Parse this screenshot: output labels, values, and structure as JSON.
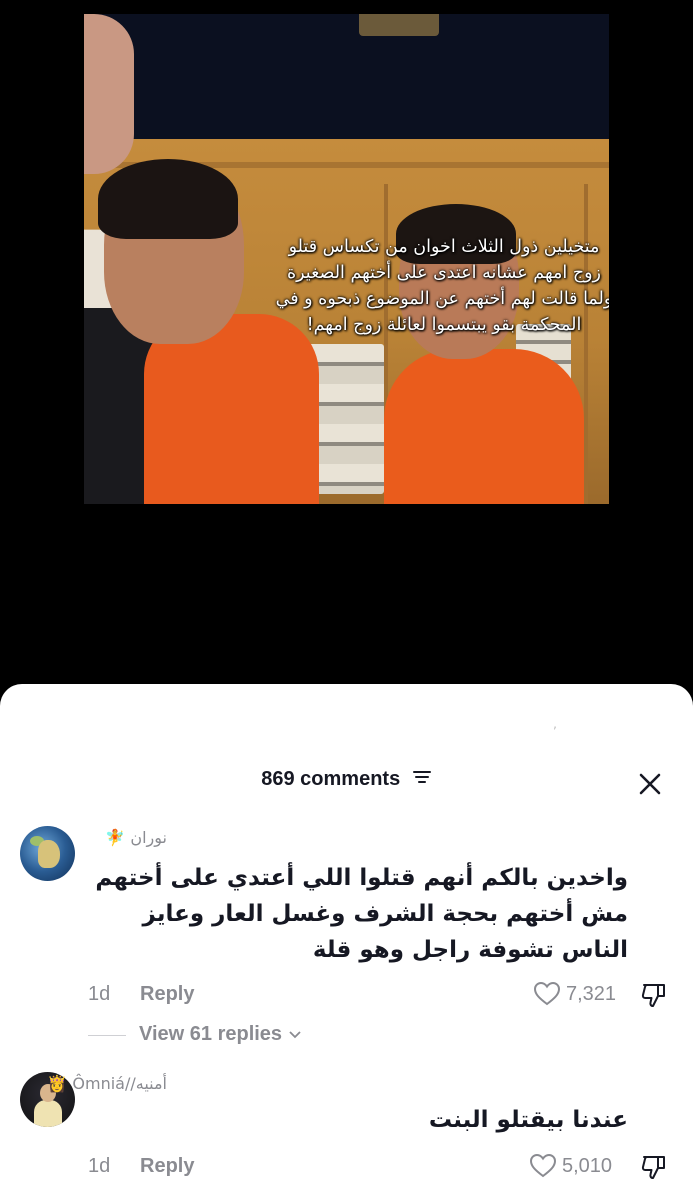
{
  "video": {
    "caption": "متخيلين ذول الثلاث اخوان من تكساس قتلو زوج امهم عشانه اعتدى على أختهم الصغيرة ولما قالت لهم أختهم عن الموضوع ذبحوه و في المحكمة بقو يبتسموا لعائلة زوج امهم!"
  },
  "comments_panel": {
    "count_label": "869 comments",
    "filter_icon": "filter-icon",
    "close_icon": "close-icon"
  },
  "comments": [
    {
      "username": "نوران",
      "username_emoji": "🧚",
      "text": "واخدين بالكم أنهم قتلوا اللي أعتدي على أختهم مش أختهم بحجة الشرف وغسل العار وعايز الناس تشوفة راجل وهو قلة",
      "time": "1d",
      "reply_label": "Reply",
      "likes": "7,321",
      "view_replies": "View 61 replies"
    },
    {
      "username": "أمنيه//Ômniá",
      "username_emoji": "👸",
      "text": "عندنا بيقتلو البنت",
      "time": "1d",
      "reply_label": "Reply",
      "likes": "5,010"
    }
  ],
  "colors": {
    "sheet_bg": "#ffffff",
    "text_primary": "#161823",
    "text_secondary": "#8a8b91"
  }
}
